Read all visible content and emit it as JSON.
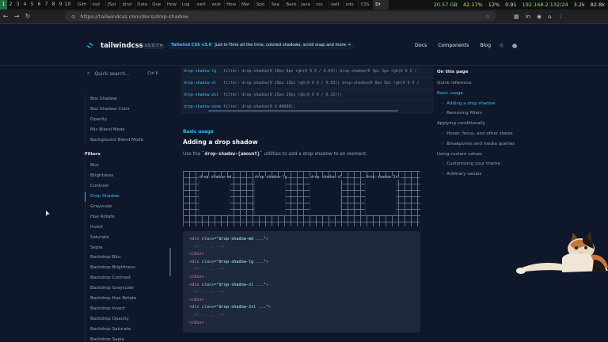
{
  "os": {
    "workspaces": [
      "1",
      "2",
      "3",
      "4",
      "5",
      "6",
      "7",
      "8",
      "9",
      "10"
    ],
    "tabs": [
      "Gith",
      "tod",
      "[Sol",
      "bind",
      "Data",
      "Que",
      "How",
      "Log",
      "swit",
      "wub",
      "How",
      "Mar",
      "Spo",
      "Sea",
      "Back",
      "java",
      "css",
      "swit",
      "xdo",
      "CSS",
      "Dr"
    ],
    "status": [
      "20.57 GB",
      "42.17%",
      "12%",
      "0.91",
      "192.168.2.132/24",
      "3.2k",
      "82.8k"
    ]
  },
  "browser": {
    "url": "https://tailwindcss.com/docs/drop-shadow"
  },
  "site": {
    "logo": "tailwindcss",
    "version": "v3.0.7",
    "announce_bold": "Tailwind CSS v3.0",
    "announce_text": "Just-in-Time all the time, colored shadows, scroll snap and more →",
    "nav": [
      "Docs",
      "Components",
      "Blog"
    ]
  },
  "sidebar": {
    "search_placeholder": "Quick search...",
    "search_kbd": "Ctrl K",
    "items_top": [
      "Box Shadow",
      "Box Shadow Color",
      "Opacity",
      "Mix Blend Mode",
      "Background Blend Mode"
    ],
    "section": "Filters",
    "items_filters": [
      "Blur",
      "Brightness",
      "Contrast",
      "Drop Shadow",
      "Grayscale",
      "Hue Rotate",
      "Invert",
      "Saturate",
      "Sepia",
      "Backdrop Blur",
      "Backdrop Brightness",
      "Backdrop Contrast",
      "Backdrop Grayscale",
      "Backdrop Hue Rotate",
      "Backdrop Invert",
      "Backdrop Opacity",
      "Backdrop Saturate",
      "Backdrop Sepia"
    ],
    "active": "Drop Shadow"
  },
  "classtable": [
    {
      "cls": "drop-shadow-lg",
      "prop": "filter: drop-shadow(0 10px 8px rgb(0 0 0 / 0.04)) drop-shadow(0 4px 3px rgb(0 0 0 /"
    },
    {
      "cls": "drop-shadow-xl",
      "prop": "filter: drop-shadow(0 20px 13px rgb(0 0 0 / 0.03)) drop-shadow(0 8px 5px rgb(0 0 0 /"
    },
    {
      "cls": "drop-shadow-2xl",
      "prop": "filter: drop-shadow(0 25px 25px rgb(0 0 0 / 0.15));"
    },
    {
      "cls": "drop-shadow-none",
      "prop": "filter: drop-shadow(0 0 #0000);"
    }
  ],
  "content": {
    "kicker": "Basic usage",
    "heading": "Adding a drop shadow",
    "para_prefix": "Use the",
    "para_code": "`drop-shadow-{amount}`",
    "para_suffix": "utilities to add a drop shadow to an element.",
    "demo_labels": [
      "drop-shadow-md",
      "drop-shadow-lg",
      "drop-shadow-xl",
      "drop-shadow-2xl"
    ],
    "example": [
      {
        "tag_open": "<div ",
        "attr": "class=",
        "str": "\"drop-shadow-md ...\"",
        "tag_close": ">"
      },
      {
        "cmt": "  <!-- ... -->"
      },
      {
        "tag_open": "</div>"
      },
      {
        "tag_open": "<div ",
        "attr": "class=",
        "str": "\"drop-shadow-lg ...\"",
        "tag_close": ">"
      },
      {
        "cmt": "  <!-- ... -->"
      },
      {
        "tag_open": "</div>"
      },
      {
        "tag_open": "<div ",
        "attr": "class=",
        "str": "\"drop-shadow-xl ...\"",
        "tag_close": ">"
      },
      {
        "cmt": "  <!-- ... -->"
      },
      {
        "tag_open": "</div>"
      },
      {
        "tag_open": "<div ",
        "attr": "class=",
        "str": "\"drop-shadow-2xl ...\"",
        "tag_close": ">"
      },
      {
        "cmt": "  <!-- ... -->"
      },
      {
        "tag_open": "</div>"
      }
    ]
  },
  "toc": {
    "title": "On this page",
    "items": [
      {
        "label": "Quick reference",
        "type": "top"
      },
      {
        "label": "Basic usage",
        "type": "active"
      },
      {
        "label": "Adding a drop shadow",
        "type": "sub-active"
      },
      {
        "label": "Removing filters",
        "type": "sub"
      },
      {
        "label": "Applying conditionally",
        "type": "top"
      },
      {
        "label": "Hover, focus, and other states",
        "type": "sub"
      },
      {
        "label": "Breakpoints and media queries",
        "type": "sub"
      },
      {
        "label": "Using custom values",
        "type": "top"
      },
      {
        "label": "Customizing your theme",
        "type": "sub"
      },
      {
        "label": "Arbitrary values",
        "type": "sub"
      }
    ]
  }
}
